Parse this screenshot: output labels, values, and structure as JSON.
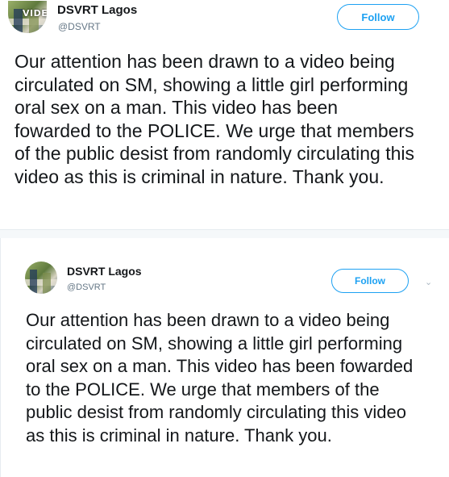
{
  "tweets": [
    {
      "author_name": "DSVRT Lagos",
      "author_handle": "@DSVRT",
      "avatar_overlay_text": "VIDE",
      "follow_label": "Follow",
      "text": "Our attention has been drawn to a video being circulated on SM, showing a little girl performing oral sex on a man. This video has been fowarded to the POLICE. We urge that members of the public desist from randomly circulating this video as this is criminal in nature. Thank you."
    },
    {
      "author_name": "DSVRT Lagos",
      "author_handle": "@DSVRT",
      "follow_label": "Follow",
      "text": "Our attention has been drawn to a video being circulated on SM, showing a little girl performing oral sex on a man. This video has been fowarded to the POLICE. We urge that members of the public desist from randomly circulating this video as this is criminal in nature. Thank you."
    }
  ],
  "colors": {
    "accent": "#1da1f2",
    "text": "#14171a",
    "secondary": "#657786"
  },
  "icons": [
    "chevron-down-icon"
  ]
}
